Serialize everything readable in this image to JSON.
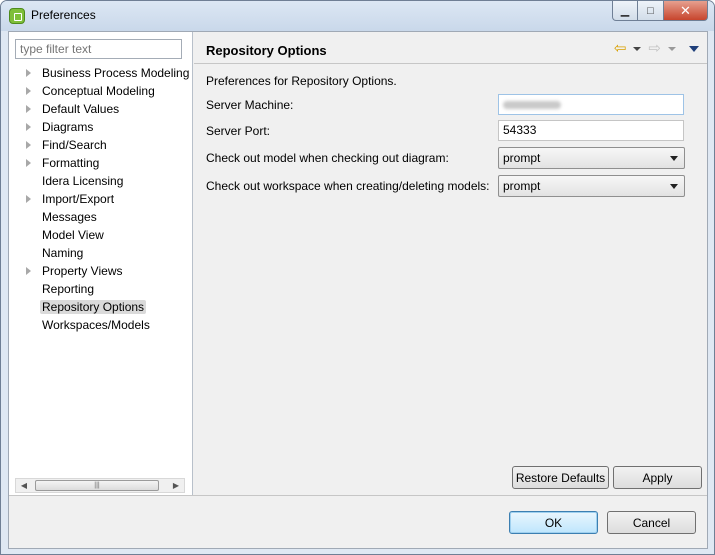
{
  "window": {
    "title": "Preferences"
  },
  "filter": {
    "placeholder": "type filter text"
  },
  "tree": {
    "items": [
      {
        "label": "Business Process Modeling",
        "expandable": true,
        "selected": false
      },
      {
        "label": "Conceptual Modeling",
        "expandable": true,
        "selected": false
      },
      {
        "label": "Default Values",
        "expandable": true,
        "selected": false
      },
      {
        "label": "Diagrams",
        "expandable": true,
        "selected": false
      },
      {
        "label": "Find/Search",
        "expandable": true,
        "selected": false
      },
      {
        "label": "Formatting",
        "expandable": true,
        "selected": false
      },
      {
        "label": "Idera Licensing",
        "expandable": false,
        "selected": false
      },
      {
        "label": "Import/Export",
        "expandable": true,
        "selected": false
      },
      {
        "label": "Messages",
        "expandable": false,
        "selected": false
      },
      {
        "label": "Model View",
        "expandable": false,
        "selected": false
      },
      {
        "label": "Naming",
        "expandable": false,
        "selected": false
      },
      {
        "label": "Property Views",
        "expandable": true,
        "selected": false
      },
      {
        "label": "Reporting",
        "expandable": false,
        "selected": false
      },
      {
        "label": "Repository Options",
        "expandable": false,
        "selected": true
      },
      {
        "label": "Workspaces/Models",
        "expandable": false,
        "selected": false
      }
    ]
  },
  "page": {
    "title": "Repository Options",
    "description": "Preferences for Repository Options.",
    "server_machine": {
      "label": "Server Machine:",
      "value": ""
    },
    "server_port": {
      "label": "Server Port:",
      "value": "54333"
    },
    "checkout_model": {
      "label": "Check out model when checking out diagram:",
      "value": "prompt"
    },
    "checkout_workspace": {
      "label": "Check out workspace when creating/deleting models:",
      "value": "prompt"
    }
  },
  "buttons": {
    "restore_defaults": "Restore Defaults",
    "apply": "Apply",
    "ok": "OK",
    "cancel": "Cancel"
  },
  "icons": {
    "back": "back-arrow-icon",
    "forward": "forward-arrow-icon",
    "view_menu": "view-menu-icon"
  },
  "colors": {
    "back_arrow": "#d8a000",
    "default_button_border": "#3c7fb1",
    "selected_item": "#dadada"
  }
}
